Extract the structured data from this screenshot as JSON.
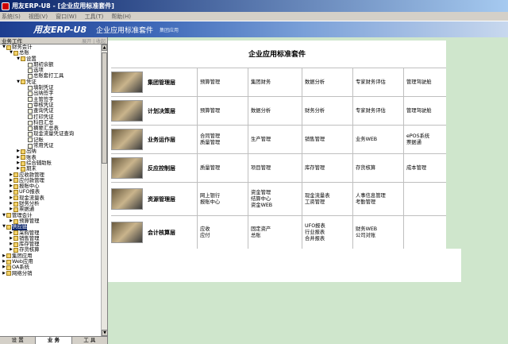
{
  "window": {
    "title": "用友ERP-U8 - [企业应用标准套件]"
  },
  "menu": [
    "系统(S)",
    "视图(V)",
    "窗口(W)",
    "工具(T)",
    "帮助(H)"
  ],
  "banner": {
    "brand": "用友ERP-U8",
    "suite": "企业应用标准套件",
    "tag": "集团应用"
  },
  "panel": {
    "title": "业务工作",
    "actions": "展开 | 收起"
  },
  "tree": [
    {
      "label": "财务会计",
      "level": 0,
      "twisty": "▼",
      "icon": "folder"
    },
    {
      "label": "总账",
      "level": 1,
      "twisty": "▼",
      "icon": "folder"
    },
    {
      "label": "设置",
      "level": 2,
      "twisty": "▼",
      "icon": "folder"
    },
    {
      "label": "期初余额",
      "level": 3,
      "twisty": "",
      "icon": "doc"
    },
    {
      "label": "选项",
      "level": 3,
      "twisty": "",
      "icon": "doc"
    },
    {
      "label": "总账套打工具",
      "level": 3,
      "twisty": "",
      "icon": "doc"
    },
    {
      "label": "凭证",
      "level": 2,
      "twisty": "▼",
      "icon": "folder"
    },
    {
      "label": "填制凭证",
      "level": 3,
      "twisty": "",
      "icon": "doc"
    },
    {
      "label": "出纳签字",
      "level": 3,
      "twisty": "",
      "icon": "doc"
    },
    {
      "label": "主管签字",
      "level": 3,
      "twisty": "",
      "icon": "doc"
    },
    {
      "label": "审核凭证",
      "level": 3,
      "twisty": "",
      "icon": "doc"
    },
    {
      "label": "查询凭证",
      "level": 3,
      "twisty": "",
      "icon": "doc"
    },
    {
      "label": "打印凭证",
      "level": 3,
      "twisty": "",
      "icon": "doc"
    },
    {
      "label": "科目汇总",
      "level": 3,
      "twisty": "",
      "icon": "doc"
    },
    {
      "label": "摘要汇总表",
      "level": 3,
      "twisty": "",
      "icon": "doc"
    },
    {
      "label": "现金流量凭证查询",
      "level": 3,
      "twisty": "",
      "icon": "doc"
    },
    {
      "label": "记账",
      "level": 3,
      "twisty": "",
      "icon": "doc"
    },
    {
      "label": "常用凭证",
      "level": 3,
      "twisty": "",
      "icon": "doc"
    },
    {
      "label": "出纳",
      "level": 2,
      "twisty": "▶",
      "icon": "folder"
    },
    {
      "label": "账表",
      "level": 2,
      "twisty": "▶",
      "icon": "folder"
    },
    {
      "label": "综合辅助账",
      "level": 2,
      "twisty": "▶",
      "icon": "folder"
    },
    {
      "label": "期末",
      "level": 2,
      "twisty": "▶",
      "icon": "folder"
    },
    {
      "label": "应收款管理",
      "level": 1,
      "twisty": "▶",
      "icon": "folder"
    },
    {
      "label": "应付款管理",
      "level": 1,
      "twisty": "▶",
      "icon": "folder"
    },
    {
      "label": "报账中心",
      "level": 1,
      "twisty": "▶",
      "icon": "folder"
    },
    {
      "label": "UFO报表",
      "level": 1,
      "twisty": "▶",
      "icon": "folder"
    },
    {
      "label": "现金流量表",
      "level": 1,
      "twisty": "▶",
      "icon": "folder"
    },
    {
      "label": "财务分析",
      "level": 1,
      "twisty": "▶",
      "icon": "folder"
    },
    {
      "label": "票据通",
      "level": 1,
      "twisty": "▶",
      "icon": "folder"
    },
    {
      "label": "管理会计",
      "level": 0,
      "twisty": "▼",
      "icon": "folder"
    },
    {
      "label": "预算管理",
      "level": 1,
      "twisty": "▶",
      "icon": "folder"
    },
    {
      "label": "供应链",
      "level": 0,
      "twisty": "▼",
      "icon": "folder",
      "selected": true
    },
    {
      "label": "采购管理",
      "level": 1,
      "twisty": "▶",
      "icon": "folder"
    },
    {
      "label": "销售管理",
      "level": 1,
      "twisty": "▶",
      "icon": "folder"
    },
    {
      "label": "库存管理",
      "level": 1,
      "twisty": "▶",
      "icon": "folder"
    },
    {
      "label": "存货核算",
      "level": 1,
      "twisty": "▶",
      "icon": "folder"
    },
    {
      "label": "集团应用",
      "level": 0,
      "twisty": "▶",
      "icon": "folder"
    },
    {
      "label": "Web应用",
      "level": 0,
      "twisty": "▶",
      "icon": "folder"
    },
    {
      "label": "OA系统",
      "level": 0,
      "twisty": "▶",
      "icon": "folder"
    },
    {
      "label": "网络分销",
      "level": 0,
      "twisty": "▶",
      "icon": "folder"
    }
  ],
  "bottom_tabs": [
    "设 置",
    "业 务",
    "工 具"
  ],
  "suite": {
    "title": "企业应用标准套件",
    "rows": [
      {
        "layer": "集团管理层",
        "cells": [
          [
            "预算管理"
          ],
          [
            "集团财务"
          ],
          [
            "数据分析"
          ],
          [
            "专家财务评估"
          ],
          [
            "管理驾驶舱"
          ]
        ]
      },
      {
        "layer": "计划决策层",
        "cells": [
          [
            "预算管理"
          ],
          [
            "数据分析"
          ],
          [
            "财务分析"
          ],
          [
            "专家财务评估"
          ],
          [
            "管理驾驶舱"
          ]
        ]
      },
      {
        "layer": "业务运作层",
        "cells": [
          [
            "合同管理",
            "质量管理"
          ],
          [
            "生产管理"
          ],
          [
            "销售管理"
          ],
          [
            "业务WEB"
          ],
          [
            "ePOS系统",
            "票据通"
          ]
        ]
      },
      {
        "layer": "反应控制层",
        "cells": [
          [
            "质量管理"
          ],
          [
            "项目管理"
          ],
          [
            "库存管理"
          ],
          [
            "存货核算"
          ],
          [
            "成本管理"
          ]
        ]
      },
      {
        "layer": "资源管理层",
        "cells": [
          [
            "网上银行",
            "报账中心"
          ],
          [
            "资金管理",
            "结算中心",
            "资金WEB"
          ],
          [
            "现金流量表",
            "工资管理"
          ],
          [
            "人事信息管理",
            "考勤管理"
          ],
          []
        ]
      },
      {
        "layer": "会计核算层",
        "cells": [
          [
            "应收",
            "应付"
          ],
          [
            "固定资产",
            "总账"
          ],
          [
            "UFO报表",
            "行业报表",
            "合并报表"
          ],
          [
            "财务WEB",
            "公司对账"
          ],
          []
        ]
      }
    ]
  }
}
